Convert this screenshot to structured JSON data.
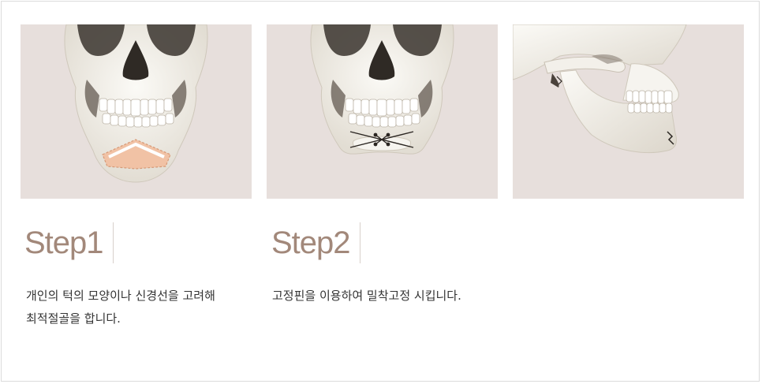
{
  "steps": [
    {
      "title": "Step1",
      "description": "개인의 턱의 모양이나 신경선을 고려해\n최적절골을 합니다."
    },
    {
      "title": "Step2",
      "description": "고정핀을 이용하여 밀착고정 시킵니다."
    }
  ],
  "colors": {
    "panel_bg": "#e7dfdc",
    "title": "#a2887a",
    "bone": "#f6f4ef",
    "cut_highlight": "#f1c2a5"
  },
  "icons": [
    "skull-front-cut-icon",
    "skull-front-pinned-icon",
    "skull-side-view-icon"
  ]
}
